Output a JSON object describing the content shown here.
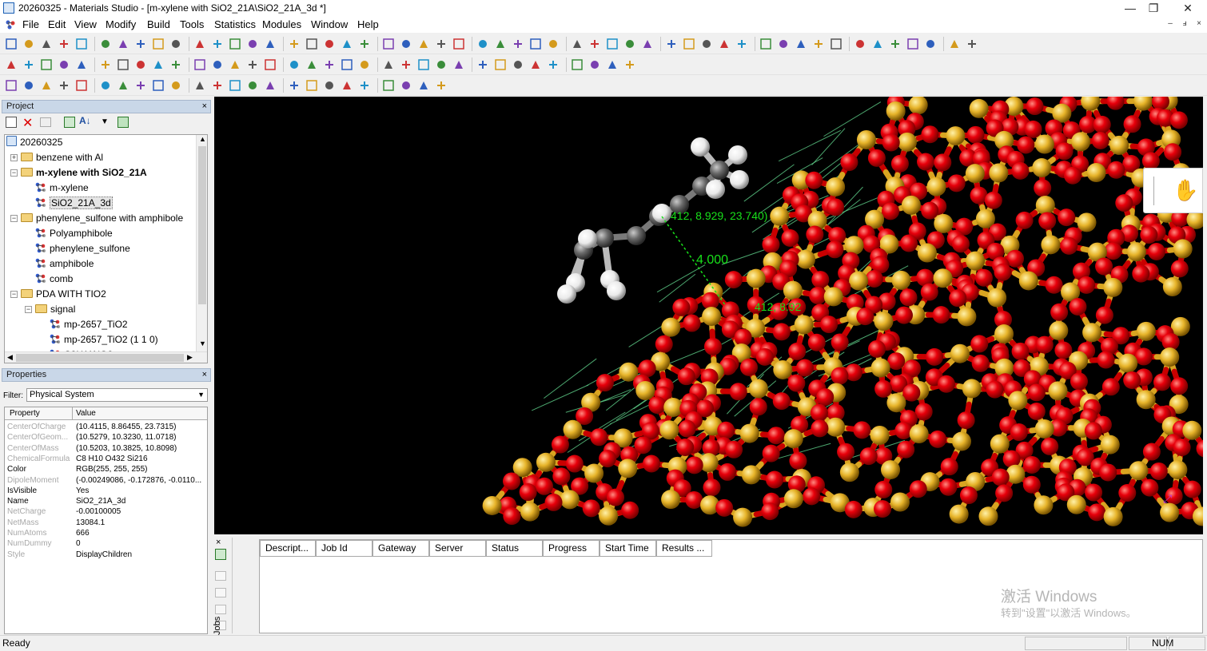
{
  "window": {
    "title": "20260325 - Materials Studio - [m-xylene with SiO2_21A\\SiO2_21A_3d *]",
    "minimize": "—",
    "restore": "❐",
    "close": "✕"
  },
  "menu": [
    "File",
    "Edit",
    "View",
    "Modify",
    "Build",
    "Tools",
    "Statistics",
    "Modules",
    "Window",
    "Help"
  ],
  "mdi_controls": [
    "–",
    "ⅎ",
    "×"
  ],
  "project": {
    "header": "Project",
    "close": "×",
    "tree": [
      {
        "label": "20260325",
        "kind": "root"
      },
      {
        "label": "benzene with Al",
        "kind": "folder"
      },
      {
        "label": "m-xylene with SiO2_21A",
        "kind": "folder",
        "bold": true
      },
      {
        "label": "m-xylene",
        "kind": "doc"
      },
      {
        "label": "SiO2_21A_3d",
        "kind": "doc",
        "selected": true
      },
      {
        "label": "phenylene_sulfone with amphibole",
        "kind": "folder"
      },
      {
        "label": "Polyamphibole",
        "kind": "doc"
      },
      {
        "label": "phenylene_sulfone",
        "kind": "doc"
      },
      {
        "label": "amphibole",
        "kind": "doc"
      },
      {
        "label": "comb",
        "kind": "doc"
      },
      {
        "label": "PDA WITH TIO2",
        "kind": "folder"
      },
      {
        "label": "signal",
        "kind": "folder"
      },
      {
        "label": "mp-2657_TiO2",
        "kind": "doc"
      },
      {
        "label": "mp-2657_TiO2 (1 1 0)",
        "kind": "doc"
      },
      {
        "label": "C8H11NO2",
        "kind": "doc"
      }
    ]
  },
  "properties": {
    "header": "Properties",
    "close": "×",
    "filter_label": "Filter:",
    "filter_value": "Physical System",
    "col_property": "Property",
    "col_value": "Value",
    "rows": [
      {
        "k": "CenterOfCharge",
        "v": "(10.4115, 8.86455, 23.7315)",
        "dim": true
      },
      {
        "k": "CenterOfGeom...",
        "v": "(10.5279, 10.3230, 11.0718)",
        "dim": true
      },
      {
        "k": "CenterOfMass",
        "v": "(10.5203, 10.3825, 10.8098)",
        "dim": true
      },
      {
        "k": "ChemicalFormula",
        "v": "C8 H10 O432 Si216",
        "dim": true
      },
      {
        "k": "Color",
        "v": "RGB(255, 255, 255)",
        "dim": false
      },
      {
        "k": "DipoleMoment",
        "v": "(-0.00249086, -0.172876, -0.0110...",
        "dim": true
      },
      {
        "k": "IsVisible",
        "v": "Yes",
        "dim": false
      },
      {
        "k": "Name",
        "v": "SiO2_21A_3d",
        "dim": false
      },
      {
        "k": "NetCharge",
        "v": "-0.00100005",
        "dim": true
      },
      {
        "k": "NetMass",
        "v": "13084.1",
        "dim": true
      },
      {
        "k": "NumAtoms",
        "v": "666",
        "dim": true
      },
      {
        "k": "NumDummy",
        "v": "0",
        "dim": true
      },
      {
        "k": "Style",
        "v": "DisplayChildren",
        "dim": true
      }
    ]
  },
  "viewer": {
    "label_top": "412, 8.929, 23.740)",
    "label_distance": "4.000",
    "label_bottom": "412, 8.92",
    "watermark_line1": "激活 Windows",
    "watermark_line2": "转到\"设置\"以激活 Windows。"
  },
  "jobs": {
    "side_label": "Jobs",
    "close": "×",
    "columns": [
      "Descript...",
      "Job Id",
      "Gateway",
      "Server",
      "Status",
      "Progress",
      "Start Time",
      "Results ..."
    ]
  },
  "status": {
    "text": "Ready",
    "num": "NUM"
  },
  "colors": {
    "oxygen": "#e8000b",
    "silicon": "#e7b42a",
    "carbon": "#6a6a6a",
    "hydrogen": "#ffffff",
    "hbond": "#5fd08a",
    "measure_label": "#18e01a"
  }
}
